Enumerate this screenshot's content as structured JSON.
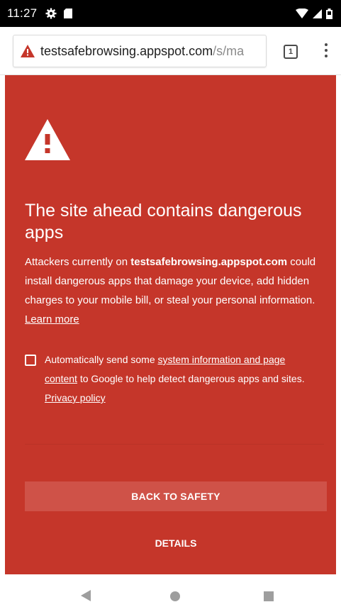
{
  "status_bar": {
    "time": "11:27",
    "icons": [
      "gear-icon",
      "sd-card-icon",
      "wifi-icon",
      "signal-icon",
      "battery-icon"
    ]
  },
  "toolbar": {
    "url_host": "testsafebrowsing.appspot.com",
    "url_path": "/s/ma",
    "tab_count": "1",
    "security_icon": "warning-triangle-icon",
    "menu_icon": "more-vert-icon"
  },
  "interstitial": {
    "background_color": "#c5362a",
    "heading": "The site ahead contains dangerous apps",
    "body": {
      "prefix": "Attackers currently on ",
      "site": "testsafebrowsing.appspot.com",
      "suffix": " could install dangerous apps that damage your device, add hidden charges to your mobile bill, or steal your personal information. ",
      "learn_more": "Learn more"
    },
    "optin": {
      "checked": false,
      "prefix": "Automatically send some ",
      "link": "system information and page content",
      "middle": " to Google to help detect dangerous apps and sites. ",
      "privacy_link": "Privacy policy"
    },
    "primary_button": "BACK TO SAFETY",
    "secondary_button": "DETAILS"
  },
  "nav_bar": {
    "icons": [
      "back-icon",
      "home-icon",
      "recents-icon"
    ]
  }
}
